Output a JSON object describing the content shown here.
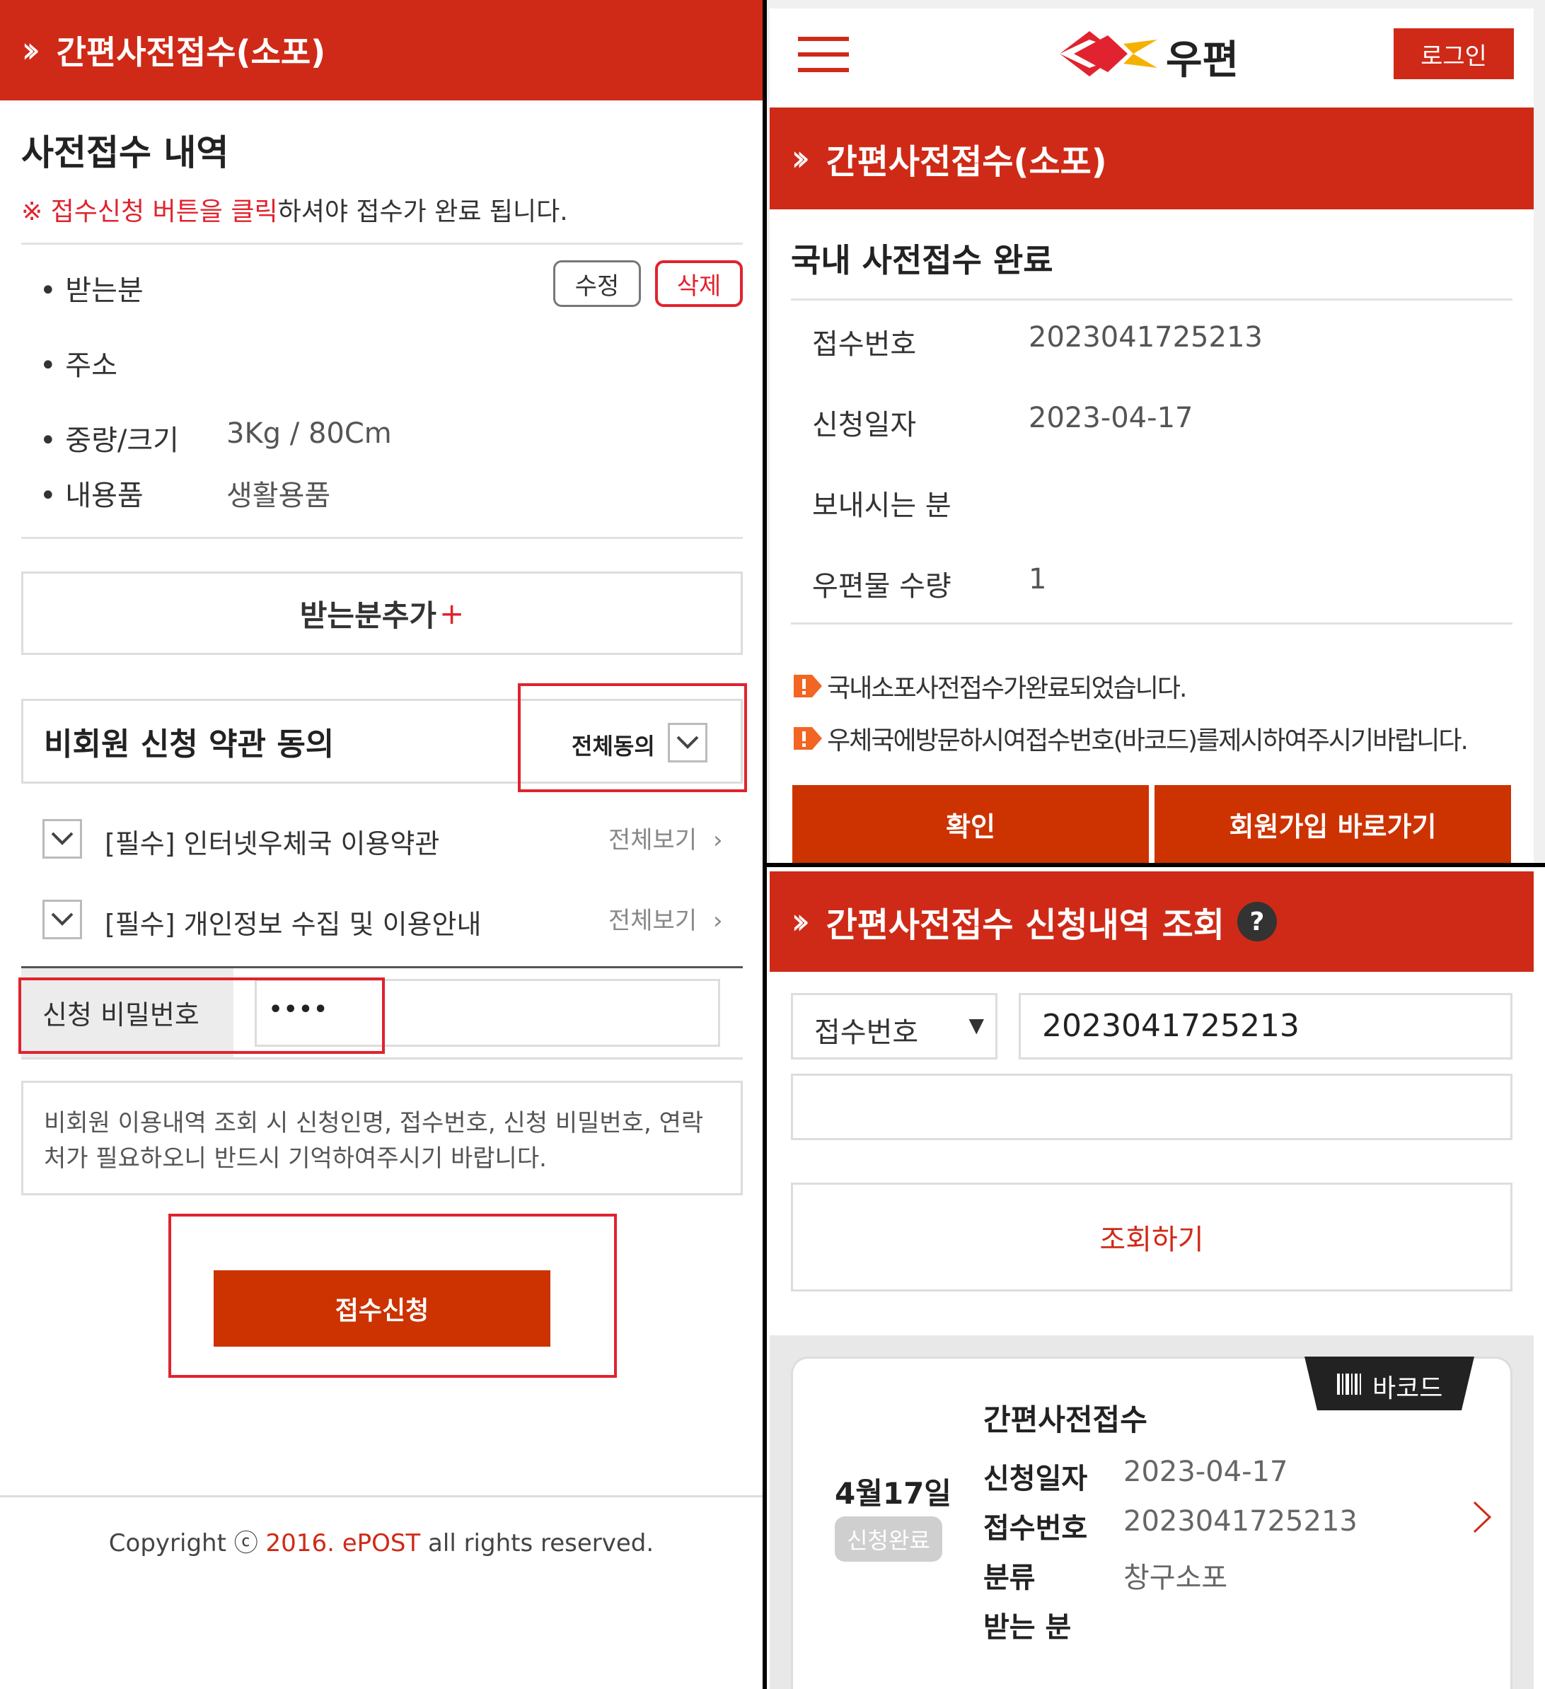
{
  "colors": {
    "brand_red": "#cf2a17",
    "button_orange": "#cc3300",
    "highlight_red": "#e0232e"
  },
  "left": {
    "header_title": "간편사전접수(소포)",
    "section_title": "사전접수 내역",
    "notice_mark": "※",
    "notice_highlight": "접수신청 버튼을 클릭",
    "notice_rest": "하셔야 접수가 완료 됩니다.",
    "receiver_label": "• 받는분",
    "edit_button": "수정",
    "delete_button": "삭제",
    "address_label": "• 주소",
    "weight_label": "• 중량/크기",
    "weight_value": "3Kg / 80Cm",
    "contents_label": "• 내용품",
    "contents_value": "생활용품",
    "add_receiver_button": "받는분추가",
    "add_plus": "+",
    "terms_title": "비회원 신청 약관 동의",
    "agree_all_label": "전체동의",
    "terms": [
      {
        "label": "[필수] 인터넷우체국 이용약관",
        "view": "전체보기"
      },
      {
        "label": "[필수] 개인정보 수집 및 이용안내",
        "view": "전체보기"
      }
    ],
    "password_label": "신청 비밀번호",
    "password_value": "••••",
    "info_text_line1": "비회원 이용내역 조회 시 신청인명, 접수번호, 신청 비밀번호, 연락",
    "info_text_line2": "처가 필요하오니 반드시 기억하여주시기 바랍니다.",
    "submit_button": "접수신청",
    "copyright_pre": "Copyright ⓒ ",
    "copyright_highlight": "2016. ePOST",
    "copyright_post": " all rights reserved."
  },
  "right_top": {
    "logo_text": "우편",
    "login_button": "로그인",
    "header_title": "간편사전접수(소포)",
    "section_title": "국내 사전접수 완료",
    "rows": [
      {
        "label": "접수번호",
        "value": "2023041725213"
      },
      {
        "label": "신청일자",
        "value": "2023-04-17"
      },
      {
        "label": "보내시는 분",
        "value": ""
      },
      {
        "label": "우편물 수량",
        "value": "1"
      }
    ],
    "messages": [
      "국내소포사전접수가완료되었습니다.",
      "우체국에방문하시여접수번호(바코드)를제시하여주시기바랍니다."
    ],
    "confirm_button": "확인",
    "signup_button": "회원가입 바로가기"
  },
  "right_bottom": {
    "header_title": "간편사전접수 신청내역 조회",
    "help_mark": "?",
    "select_value": "접수번호",
    "select_arrow": "▼",
    "search_value": "2023041725213",
    "search_button": "조회하기",
    "card": {
      "barcode_label": "바코드",
      "date": "4월17일",
      "status": "신청완료",
      "title": "간편사전접수",
      "rows": [
        {
          "label": "신청일자",
          "value": "2023-04-17"
        },
        {
          "label": "접수번호",
          "value": "2023041725213"
        },
        {
          "label": "분류",
          "value": "창구소포"
        },
        {
          "label": "받는 분",
          "value": ""
        }
      ]
    }
  }
}
